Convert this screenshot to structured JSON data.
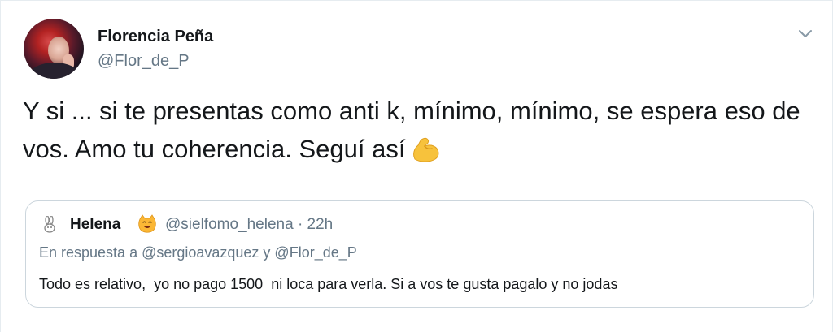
{
  "tweet": {
    "author": {
      "display_name": "Florencia Peña",
      "handle": "@Flor_de_P",
      "avatar_icon": "profile-photo"
    },
    "menu_icon": "chevron-down-icon",
    "text": "Y si ... si te presentas como anti k, mínimo, mínimo, se espera eso de vos. Amo tu coherencia. Seguí así",
    "emoji": "flexed-biceps-emoji"
  },
  "quoted_tweet": {
    "author_icon": "bunny-icon",
    "display_name": "Helena",
    "name_emoji": "smiling-cat-emoji",
    "handle_time": "@sielfomo_helena · 22h",
    "reply_context": "En respuesta a @sergioavazquez y @Flor_de_P",
    "text": "Todo es relativo,  yo no pago 1500  ni loca para verla. Si a vos te gusta pagalo y no jodas"
  },
  "colors": {
    "primary_text": "#14171a",
    "secondary_text": "#657786",
    "border": "#ccd6dd",
    "emoji_yellow": "#f7c23c"
  }
}
